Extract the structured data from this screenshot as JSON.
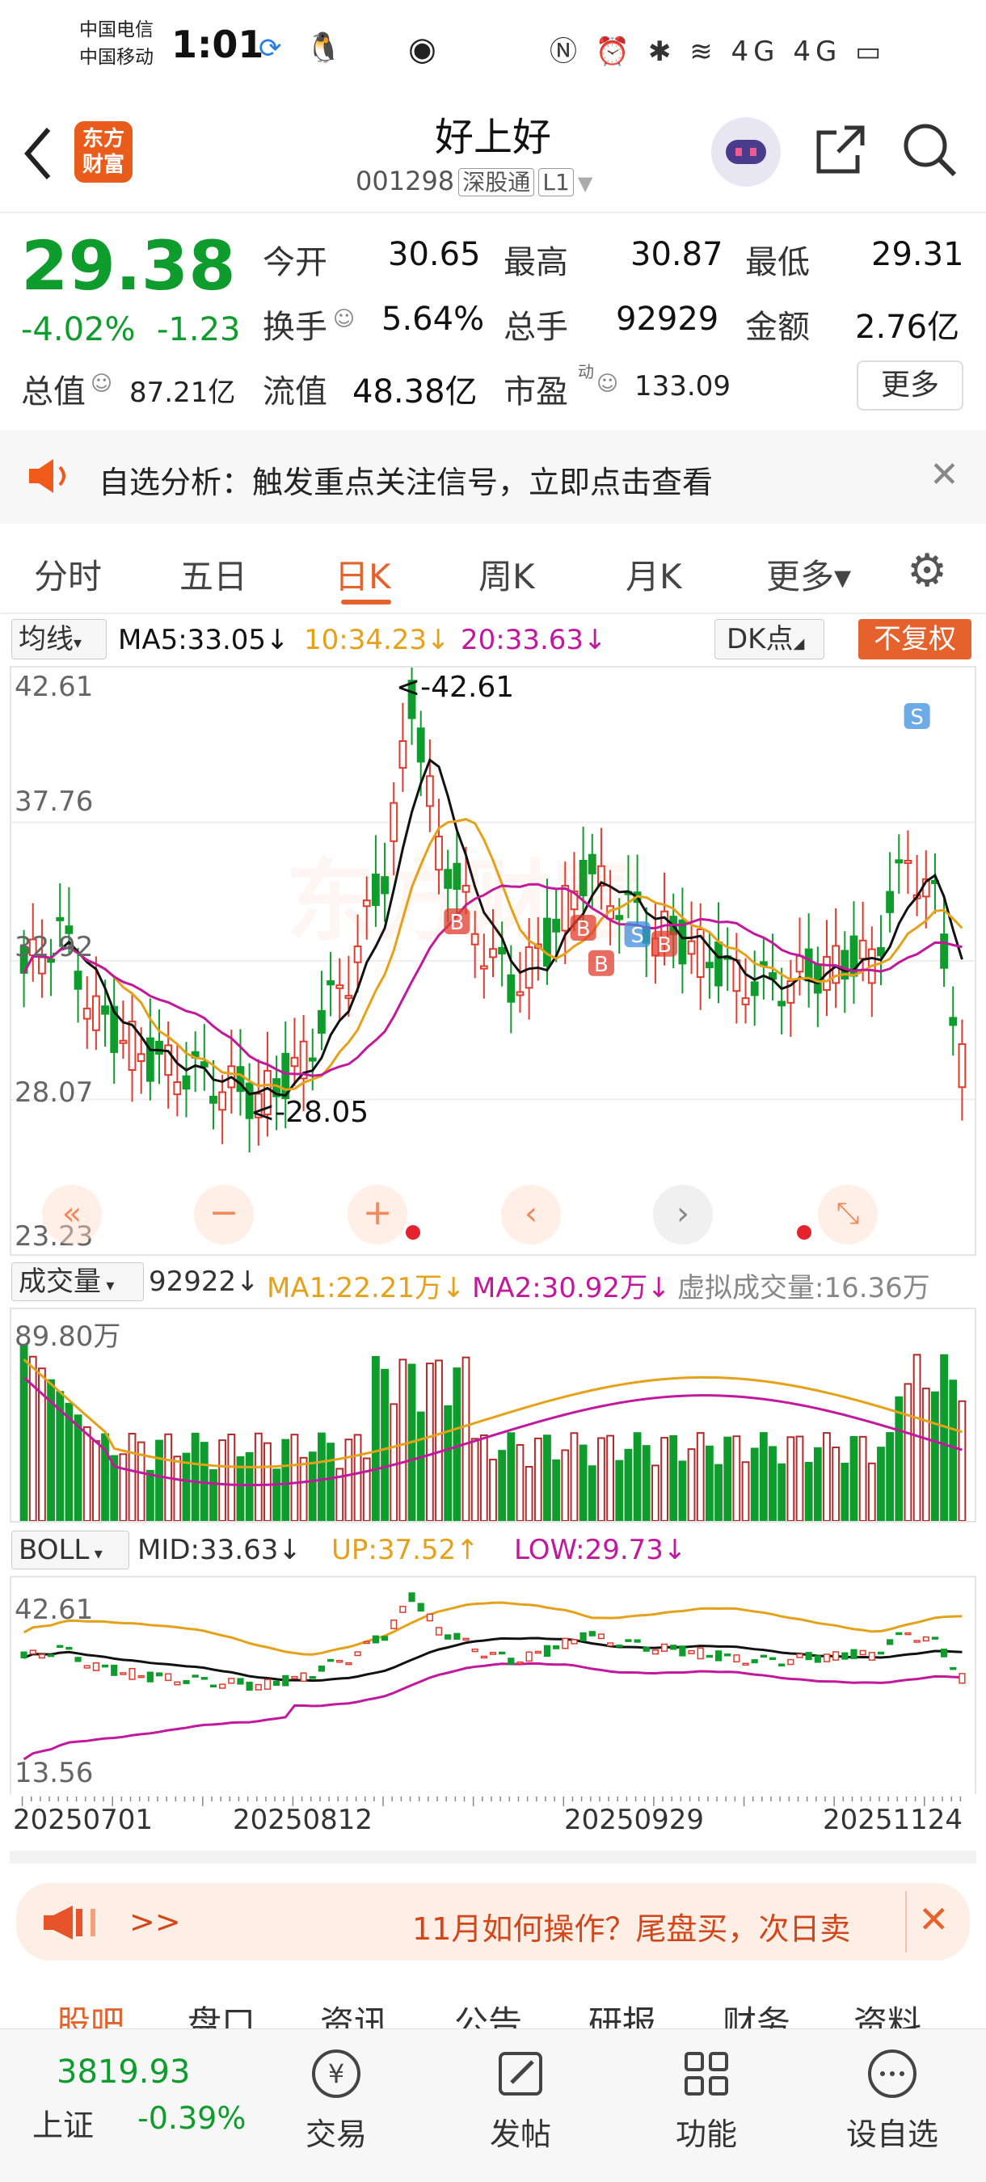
{
  "status_bar": {
    "carrier1": "中国电信",
    "carrier2": "中国移动",
    "time": "1:01",
    "icons_right": "Ⓝ ⏰ ✱ ≋ 4G 4G ▭"
  },
  "header": {
    "back_icon": "chevron-left-icon",
    "logo_line1": "东方",
    "logo_line2": "财富",
    "stock_name": "好上好",
    "stock_code": "001298",
    "market_tag": "深股通",
    "level_tag": "L1",
    "share_icon": "share-icon",
    "search_icon": "search-icon"
  },
  "quote": {
    "price": "29.38",
    "change_pct": "-4.02%",
    "change": "-1.23",
    "open_label": "今开",
    "open_value": "30.65",
    "high_label": "最高",
    "high_value": "30.87",
    "low_label": "最低",
    "low_value": "29.31",
    "turnover_label": "换手",
    "turnover_value": "5.64%",
    "volume_label": "总手",
    "volume_value": "92929",
    "amount_label": "金额",
    "amount_value": "2.76亿",
    "total_cap_label": "总值",
    "total_cap_value": "87.21亿",
    "float_cap_label": "流值",
    "float_cap_value": "48.38亿",
    "pe_label": "市盈",
    "pe_sup": "动",
    "pe_value": "133.09",
    "more_button": "更多"
  },
  "notice": {
    "text": "自选分析：触发重点关注信号，立即点击查看"
  },
  "tabs": [
    {
      "label": "分时"
    },
    {
      "label": "五日"
    },
    {
      "label": "日K"
    },
    {
      "label": "周K"
    },
    {
      "label": "月K"
    },
    {
      "label": "更多▾"
    }
  ],
  "kline": {
    "ma_select": "均线",
    "ma5": "MA5:33.05↓",
    "ma10": "10:34.23↓",
    "ma20": "20:33.63↓",
    "dk_select": "DK点",
    "fq_button": "不复权",
    "y_labels": [
      "42.61",
      "37.76",
      "32.92",
      "28.07",
      "23.23"
    ],
    "max_marker": "<-42.61",
    "min_marker": "<-28.05"
  },
  "volume": {
    "select": "成交量",
    "vol": "92922↓",
    "ma1": "MA1:22.21万↓",
    "ma2": "MA2:30.92万↓",
    "virtual": "虚拟成交量:16.36万",
    "y_top": "89.80万"
  },
  "boll": {
    "select": "BOLL",
    "mid": "MID:33.63↓",
    "up": "UP:37.52↑",
    "low": "LOW:29.73↓",
    "y_top": "42.61",
    "y_bottom": "13.56"
  },
  "dates": [
    "20250701",
    "20250812",
    "20250929",
    "20251124"
  ],
  "ad": {
    "prefix": ">>",
    "text": "11月如何操作？尾盘买，次日卖"
  },
  "content_tabs": [
    "股吧",
    "盘口",
    "资讯",
    "公告",
    "研报",
    "财务",
    "资料"
  ],
  "index_bar": {
    "name": "上证",
    "value": "3819.93",
    "change": "-0.39%"
  },
  "bottom_nav": [
    {
      "label": "交易",
      "icon": "yen-circle-icon"
    },
    {
      "label": "发帖",
      "icon": "edit-icon"
    },
    {
      "label": "功能",
      "icon": "grid-icon"
    },
    {
      "label": "设自选",
      "icon": "more-circle-icon"
    }
  ],
  "colors": {
    "up": "#e23b2e",
    "down": "#0e9c2d",
    "accent": "#e5622c",
    "ma5": "#111111",
    "ma10": "#e6a11a",
    "ma20": "#c2189d"
  }
}
